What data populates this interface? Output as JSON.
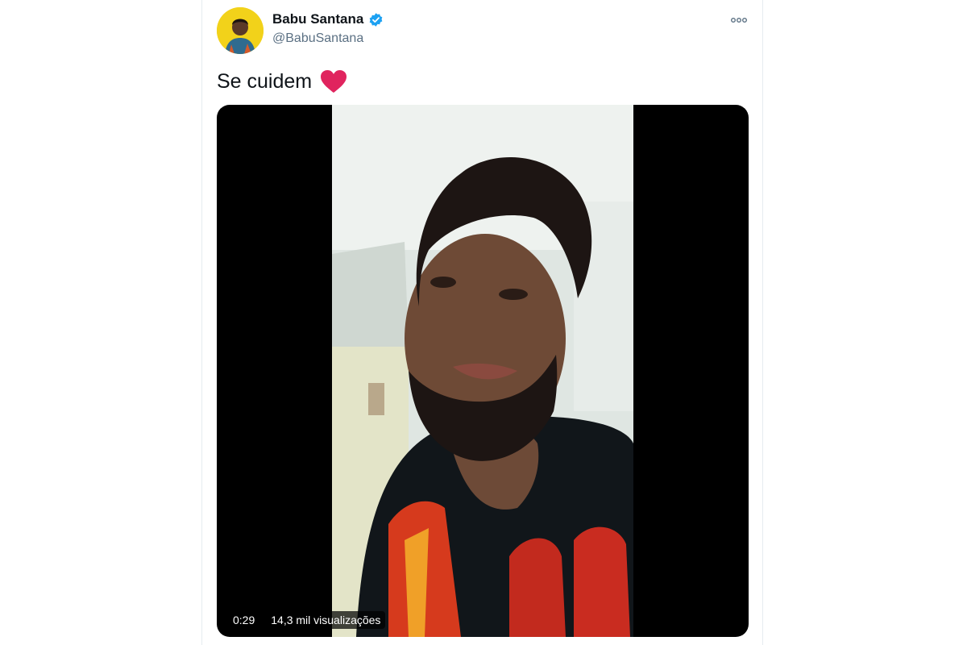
{
  "tweet": {
    "author_name": "Babu Santana",
    "handle": "@BabuSantana",
    "text": "Se cuidem",
    "emoji": "heart-icon",
    "video": {
      "duration": "0:29",
      "views": "14,3 mil visualizações"
    }
  },
  "icons": {
    "verified": "verified-badge-icon",
    "more": "more-options-icon"
  },
  "colors": {
    "verified": "#1da1f2",
    "heart": "#e0245e",
    "handle": "#5b7083",
    "avatar_bg": "#f2d21a"
  }
}
